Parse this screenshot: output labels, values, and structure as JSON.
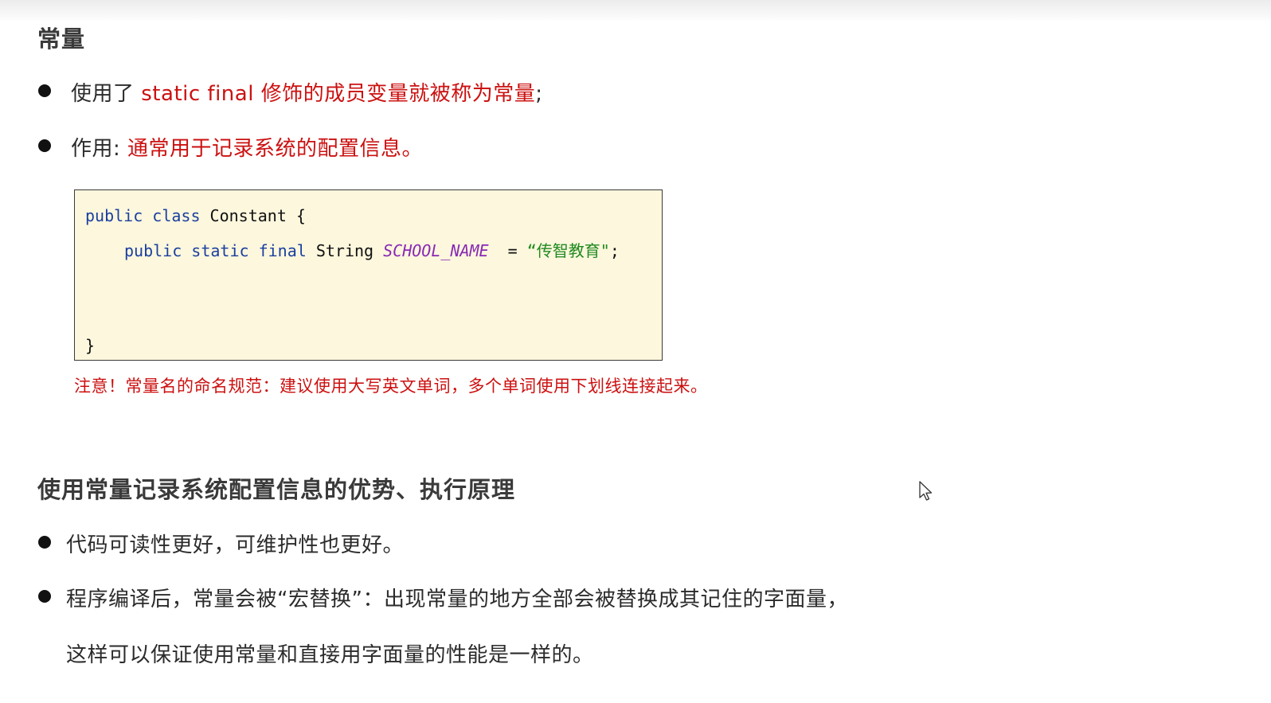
{
  "section1": {
    "title": "常量",
    "bullet1": {
      "prefix": "使用了 ",
      "highlight": "static final 修饰的成员变量就被称为常量",
      "suffix": ";"
    },
    "bullet2": {
      "prefix": "作用: ",
      "highlight": "通常用于记录系统的配置信息。"
    }
  },
  "code": {
    "line1": {
      "kw1": "public",
      "kw2": "class",
      "name": " Constant {"
    },
    "line2": {
      "kw1": "public",
      "kw2": "static",
      "kw3": "final",
      "type": " String ",
      "constant": "SCHOOL_NAME",
      "assign": "  = ",
      "value": "“传智教育\"",
      "end": ";"
    },
    "line3": "}"
  },
  "note": "注意！常量名的命名规范：建议使用大写英文单词，多个单词使用下划线连接起来。",
  "section2": {
    "title": "使用常量记录系统配置信息的优势、执行原理",
    "bullet1": "代码可读性更好，可维护性也更好。",
    "bullet2_line1": "程序编译后，常量会被“宏替换”：出现常量的地方全部会被替换成其记住的字面量，",
    "bullet2_line2": "这样可以保证使用常量和直接用字面量的性能是一样的。"
  },
  "colors": {
    "highlight": "#cc1010",
    "keyword": "#1a3fa0",
    "constant": "#8a2ab5",
    "string": "#1f8a1f",
    "code_bg": "#fcf7dd"
  }
}
